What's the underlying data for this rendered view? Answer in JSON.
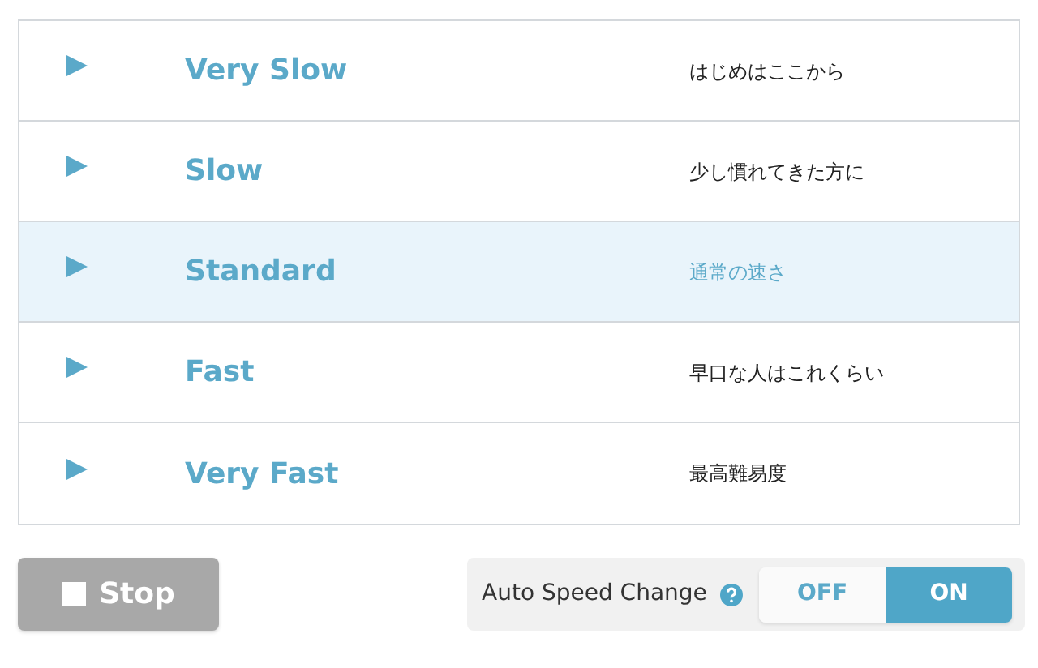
{
  "speeds": [
    {
      "label": "Very Slow",
      "description": "はじめはここから",
      "selected": false
    },
    {
      "label": "Slow",
      "description": "少し慣れてきた方に",
      "selected": false
    },
    {
      "label": "Standard",
      "description": "通常の速さ",
      "selected": true
    },
    {
      "label": "Fast",
      "description": "早口な人はこれくらい",
      "selected": false
    },
    {
      "label": "Very Fast",
      "description": "最高難易度",
      "selected": false
    }
  ],
  "stop_button": {
    "label": "Stop",
    "disabled": true
  },
  "auto_speed": {
    "label": "Auto Speed Change",
    "options": [
      {
        "label": "OFF",
        "selected": false
      },
      {
        "label": "ON",
        "selected": true
      }
    ]
  }
}
